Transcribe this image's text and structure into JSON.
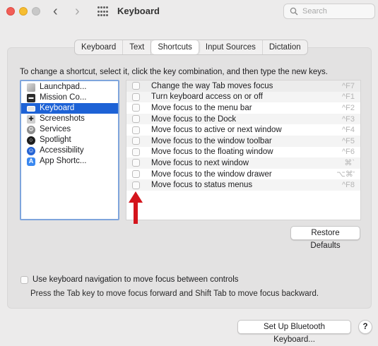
{
  "window": {
    "title": "Keyboard"
  },
  "search": {
    "placeholder": "Search"
  },
  "tabs": [
    {
      "label": "Keyboard",
      "active": false
    },
    {
      "label": "Text",
      "active": false
    },
    {
      "label": "Shortcuts",
      "active": true
    },
    {
      "label": "Input Sources",
      "active": false
    },
    {
      "label": "Dictation",
      "active": false
    }
  ],
  "instruction": "To change a shortcut, select it, click the key combination, and then type the new keys.",
  "categories": [
    {
      "label": "Launchpad...",
      "icon": "launchpad-icon"
    },
    {
      "label": "Mission Co...",
      "icon": "mission-control-icon"
    },
    {
      "label": "Keyboard",
      "icon": "keyboard-icon",
      "selected": true
    },
    {
      "label": "Screenshots",
      "icon": "screenshot-icon"
    },
    {
      "label": "Services",
      "icon": "gear-icon"
    },
    {
      "label": "Spotlight",
      "icon": "spotlight-icon"
    },
    {
      "label": "Accessibility",
      "icon": "accessibility-icon"
    },
    {
      "label": "App Shortc...",
      "icon": "app-shortcuts-icon"
    }
  ],
  "shortcuts": [
    {
      "label": "Change the way Tab moves focus",
      "key": "^F7",
      "checked": false
    },
    {
      "label": "Turn keyboard access on or off",
      "key": "^F1",
      "checked": false
    },
    {
      "label": "Move focus to the menu bar",
      "key": "^F2",
      "checked": false
    },
    {
      "label": "Move focus to the Dock",
      "key": "^F3",
      "checked": false
    },
    {
      "label": "Move focus to active or next window",
      "key": "^F4",
      "checked": false
    },
    {
      "label": "Move focus to the window toolbar",
      "key": "^F5",
      "checked": false
    },
    {
      "label": "Move focus to the floating window",
      "key": "^F6",
      "checked": false
    },
    {
      "label": "Move focus to next window",
      "key": "⌘`",
      "checked": false
    },
    {
      "label": "Move focus to the window drawer",
      "key": "⌥⌘'",
      "checked": false
    },
    {
      "label": "Move focus to status menus",
      "key": "^F8",
      "checked": false
    }
  ],
  "restore_defaults": "Restore Defaults",
  "full_keyboard": {
    "label": "Use keyboard navigation to move focus between controls",
    "checked": false,
    "help": "Press the Tab key to move focus forward and Shift Tab to move focus backward."
  },
  "bluetooth_button": "Set Up Bluetooth Keyboard...",
  "help_button": "?",
  "colors": {
    "selection": "#1d62d6",
    "annotation_arrow": "#d4141c"
  }
}
